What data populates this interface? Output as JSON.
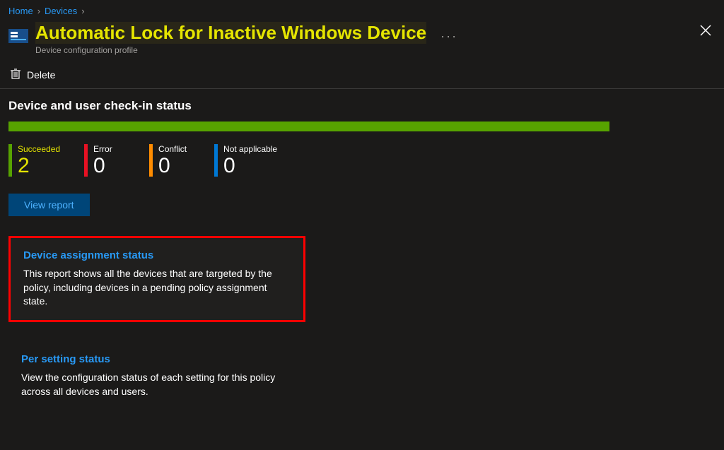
{
  "breadcrumb": {
    "home": "Home",
    "devices": "Devices"
  },
  "header": {
    "title": "Automatic Lock for Inactive Windows Device",
    "subtitle": "Device configuration profile",
    "more": "···"
  },
  "commands": {
    "delete": "Delete"
  },
  "section": {
    "title": "Device and user check-in status"
  },
  "stats": {
    "succeeded": {
      "label": "Succeeded",
      "value": "2"
    },
    "error": {
      "label": "Error",
      "value": "0"
    },
    "conflict": {
      "label": "Conflict",
      "value": "0"
    },
    "na": {
      "label": "Not applicable",
      "value": "0"
    }
  },
  "buttons": {
    "view_report": "View report"
  },
  "cards": {
    "device_assignment": {
      "title": "Device assignment status",
      "desc": "This report shows all the devices that are targeted by the policy, including devices in a pending policy assignment state."
    },
    "per_setting": {
      "title": "Per setting status",
      "desc": "View the configuration status of each setting for this policy across all devices and users."
    }
  },
  "chart_data": {
    "type": "bar",
    "categories": [
      "Succeeded",
      "Error",
      "Conflict",
      "Not applicable"
    ],
    "values": [
      2,
      0,
      0,
      0
    ],
    "title": "Device and user check-in status",
    "xlabel": "",
    "ylabel": "",
    "ylim": [
      0,
      2
    ]
  }
}
